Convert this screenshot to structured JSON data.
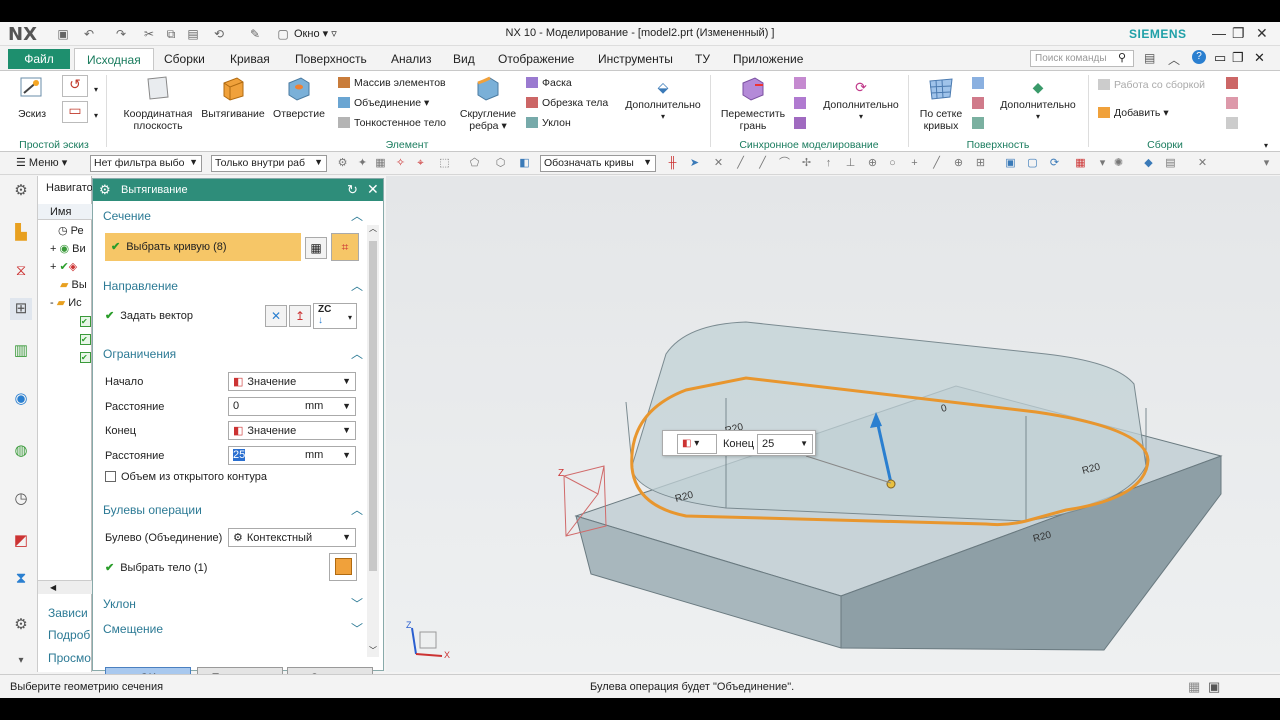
{
  "app": {
    "logo": "NX",
    "title": "NX 10 - Моделирование - [model2.prt (Измененный) ]",
    "brand": "SIEMENS",
    "window_menu": "Окно"
  },
  "menu": {
    "file": "Файл",
    "tabs": [
      "Исходная",
      "Сборки",
      "Кривая",
      "Поверхность",
      "Анализ",
      "Вид",
      "Отображение",
      "Инструменты",
      "ТУ",
      "Приложение"
    ],
    "active_tab": "Исходная",
    "search_placeholder": "Поиск команды"
  },
  "ribbon": {
    "sketch": "Эскиз",
    "sketch_group": "Простой эскиз",
    "datum_plane": [
      "Координатная",
      "плоскость"
    ],
    "extrude": "Вытягивание",
    "hole": "Отверстие",
    "pattern_feature": "Массив элементов",
    "unite": "Объединение",
    "shell": "Тонкостенное тело",
    "edge_blend": [
      "Скругление",
      "ребра"
    ],
    "chamfer": "Фаска",
    "trim_body": "Обрезка тела",
    "draft": "Уклон",
    "more1": "Дополнительно",
    "feature_group": "Элемент",
    "move_face": [
      "Переместить",
      "грань"
    ],
    "more2": "Дополнительно",
    "sync_group": "Синхронное моделирование",
    "through_curves": [
      "По сетке",
      "кривых"
    ],
    "more3": "Дополнительно",
    "surface_group": "Поверхность",
    "assembly_work": "Работа со сборкой",
    "add": "Добавить",
    "assembly_group": "Сборки"
  },
  "toolbar": {
    "menu": "Меню",
    "filter": "Нет фильтра выбо",
    "scope": "Только внутри раб",
    "curve_rule": "Обозначать кривы"
  },
  "navigator": {
    "title": "Навигато",
    "col_name": "Имя",
    "items": [
      "Ре",
      "Ви",
      "",
      "Вы",
      "Ис"
    ],
    "bottom": [
      "Зависи",
      "Подроб",
      "Просмо"
    ]
  },
  "dialog": {
    "title": "Вытягивание",
    "sections": {
      "section": "Сечение",
      "direction": "Направление",
      "limits": "Ограничения",
      "boolean": "Булевы операции",
      "draft": "Уклон",
      "offset": "Смещение"
    },
    "select_curve": "Выбрать кривую (8)",
    "specify_vector": "Задать вектор",
    "vector_option": "ZC",
    "start_label": "Начало",
    "start_value": "Значение",
    "distance_label": "Расстояние",
    "start_distance": "0",
    "unit": "mm",
    "end_label": "Конец",
    "end_value": "Значение",
    "end_distance": "25",
    "open_profile": "Объем из открытого контура",
    "boolean_label": "Булево (Объединение)",
    "boolean_value": "Контекстный",
    "select_body": "Выбрать тело (1)",
    "ok": "< OK >",
    "apply": "Применить",
    "cancel": "Отмена"
  },
  "viewport": {
    "end_label": "Конец",
    "end_value": "25",
    "radius_labels": [
      "R20",
      "R20",
      "R20",
      "R20"
    ],
    "axis_z": "Z",
    "axis_x": "X",
    "handle_label": "0"
  },
  "status": {
    "left": "Выберите геометрию сечения",
    "center": "Булева операция будет \"Объединение\"."
  },
  "colors": {
    "accent": "#1e8f6e",
    "dialog_header": "#2e8d7a",
    "section_title": "#2c7a95",
    "selected_row": "#f6c667",
    "curve": "#e8962e"
  }
}
